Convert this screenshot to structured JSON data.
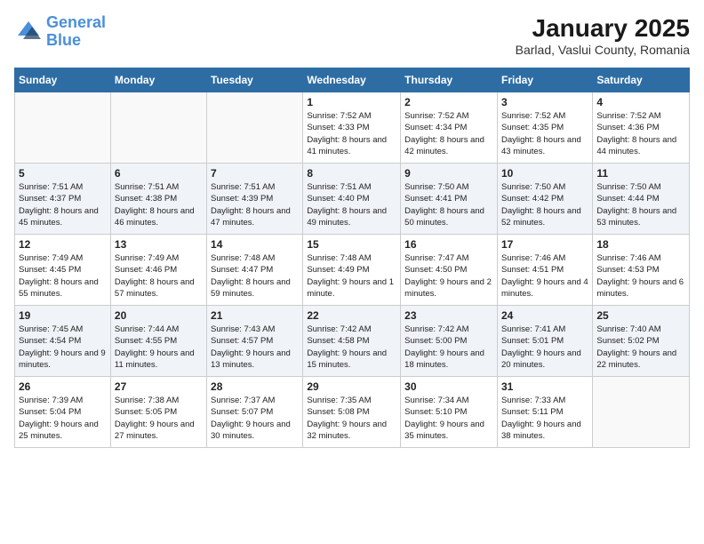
{
  "logo": {
    "line1": "General",
    "line2": "Blue"
  },
  "title": "January 2025",
  "subtitle": "Barlad, Vaslui County, Romania",
  "weekdays": [
    "Sunday",
    "Monday",
    "Tuesday",
    "Wednesday",
    "Thursday",
    "Friday",
    "Saturday"
  ],
  "weeks": [
    [
      {
        "day": "",
        "content": ""
      },
      {
        "day": "",
        "content": ""
      },
      {
        "day": "",
        "content": ""
      },
      {
        "day": "1",
        "content": "Sunrise: 7:52 AM\nSunset: 4:33 PM\nDaylight: 8 hours and 41 minutes."
      },
      {
        "day": "2",
        "content": "Sunrise: 7:52 AM\nSunset: 4:34 PM\nDaylight: 8 hours and 42 minutes."
      },
      {
        "day": "3",
        "content": "Sunrise: 7:52 AM\nSunset: 4:35 PM\nDaylight: 8 hours and 43 minutes."
      },
      {
        "day": "4",
        "content": "Sunrise: 7:52 AM\nSunset: 4:36 PM\nDaylight: 8 hours and 44 minutes."
      }
    ],
    [
      {
        "day": "5",
        "content": "Sunrise: 7:51 AM\nSunset: 4:37 PM\nDaylight: 8 hours and 45 minutes."
      },
      {
        "day": "6",
        "content": "Sunrise: 7:51 AM\nSunset: 4:38 PM\nDaylight: 8 hours and 46 minutes."
      },
      {
        "day": "7",
        "content": "Sunrise: 7:51 AM\nSunset: 4:39 PM\nDaylight: 8 hours and 47 minutes."
      },
      {
        "day": "8",
        "content": "Sunrise: 7:51 AM\nSunset: 4:40 PM\nDaylight: 8 hours and 49 minutes."
      },
      {
        "day": "9",
        "content": "Sunrise: 7:50 AM\nSunset: 4:41 PM\nDaylight: 8 hours and 50 minutes."
      },
      {
        "day": "10",
        "content": "Sunrise: 7:50 AM\nSunset: 4:42 PM\nDaylight: 8 hours and 52 minutes."
      },
      {
        "day": "11",
        "content": "Sunrise: 7:50 AM\nSunset: 4:44 PM\nDaylight: 8 hours and 53 minutes."
      }
    ],
    [
      {
        "day": "12",
        "content": "Sunrise: 7:49 AM\nSunset: 4:45 PM\nDaylight: 8 hours and 55 minutes."
      },
      {
        "day": "13",
        "content": "Sunrise: 7:49 AM\nSunset: 4:46 PM\nDaylight: 8 hours and 57 minutes."
      },
      {
        "day": "14",
        "content": "Sunrise: 7:48 AM\nSunset: 4:47 PM\nDaylight: 8 hours and 59 minutes."
      },
      {
        "day": "15",
        "content": "Sunrise: 7:48 AM\nSunset: 4:49 PM\nDaylight: 9 hours and 1 minute."
      },
      {
        "day": "16",
        "content": "Sunrise: 7:47 AM\nSunset: 4:50 PM\nDaylight: 9 hours and 2 minutes."
      },
      {
        "day": "17",
        "content": "Sunrise: 7:46 AM\nSunset: 4:51 PM\nDaylight: 9 hours and 4 minutes."
      },
      {
        "day": "18",
        "content": "Sunrise: 7:46 AM\nSunset: 4:53 PM\nDaylight: 9 hours and 6 minutes."
      }
    ],
    [
      {
        "day": "19",
        "content": "Sunrise: 7:45 AM\nSunset: 4:54 PM\nDaylight: 9 hours and 9 minutes."
      },
      {
        "day": "20",
        "content": "Sunrise: 7:44 AM\nSunset: 4:55 PM\nDaylight: 9 hours and 11 minutes."
      },
      {
        "day": "21",
        "content": "Sunrise: 7:43 AM\nSunset: 4:57 PM\nDaylight: 9 hours and 13 minutes."
      },
      {
        "day": "22",
        "content": "Sunrise: 7:42 AM\nSunset: 4:58 PM\nDaylight: 9 hours and 15 minutes."
      },
      {
        "day": "23",
        "content": "Sunrise: 7:42 AM\nSunset: 5:00 PM\nDaylight: 9 hours and 18 minutes."
      },
      {
        "day": "24",
        "content": "Sunrise: 7:41 AM\nSunset: 5:01 PM\nDaylight: 9 hours and 20 minutes."
      },
      {
        "day": "25",
        "content": "Sunrise: 7:40 AM\nSunset: 5:02 PM\nDaylight: 9 hours and 22 minutes."
      }
    ],
    [
      {
        "day": "26",
        "content": "Sunrise: 7:39 AM\nSunset: 5:04 PM\nDaylight: 9 hours and 25 minutes."
      },
      {
        "day": "27",
        "content": "Sunrise: 7:38 AM\nSunset: 5:05 PM\nDaylight: 9 hours and 27 minutes."
      },
      {
        "day": "28",
        "content": "Sunrise: 7:37 AM\nSunset: 5:07 PM\nDaylight: 9 hours and 30 minutes."
      },
      {
        "day": "29",
        "content": "Sunrise: 7:35 AM\nSunset: 5:08 PM\nDaylight: 9 hours and 32 minutes."
      },
      {
        "day": "30",
        "content": "Sunrise: 7:34 AM\nSunset: 5:10 PM\nDaylight: 9 hours and 35 minutes."
      },
      {
        "day": "31",
        "content": "Sunrise: 7:33 AM\nSunset: 5:11 PM\nDaylight: 9 hours and 38 minutes."
      },
      {
        "day": "",
        "content": ""
      }
    ]
  ]
}
